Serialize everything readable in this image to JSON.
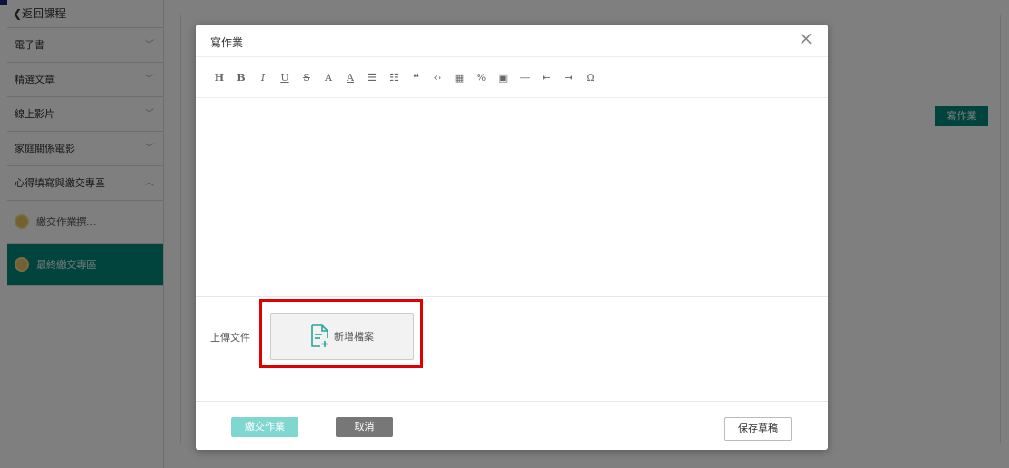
{
  "sidebar": {
    "back_label": "❮返回課程",
    "items": [
      {
        "label": "電子書",
        "chevron": "﹀"
      },
      {
        "label": "精選文章",
        "chevron": "﹀"
      },
      {
        "label": "線上影片",
        "chevron": "﹀"
      },
      {
        "label": "家庭關係電影",
        "chevron": "﹀"
      },
      {
        "label": "心得填寫與繳交專區",
        "chevron": "︿"
      }
    ],
    "subitems": [
      {
        "label": "繳交作業撰...",
        "icon": "coin-icon"
      },
      {
        "label": "最終繳交專區",
        "icon": "coin-icon",
        "active": true
      }
    ]
  },
  "page": {
    "write_homework_button": "寫作業"
  },
  "modal": {
    "title": "寫作業",
    "close_icon": "×",
    "toolbar": [
      "H",
      "B",
      "I",
      "U",
      "S",
      "A",
      "A",
      "☰",
      "☷",
      "❝",
      "‹›",
      "▦",
      "%",
      "▣",
      "—",
      "⇤",
      "⇥",
      "Ω"
    ],
    "upload_label": "上傳文件",
    "add_file_label": "新增檔案",
    "submit_label": "繳交作業",
    "cancel_label": "取消",
    "save_draft_label": "保存草稿"
  },
  "colors": {
    "accent": "#00897b",
    "submit_disabled": "#7fd7cf",
    "highlight": "#e00000"
  }
}
